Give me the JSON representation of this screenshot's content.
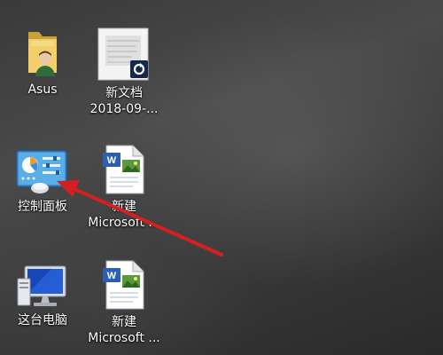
{
  "desktop": {
    "icons": [
      {
        "id": "asus",
        "label_lines": [
          "Asus"
        ],
        "icon": "user-folder-icon"
      },
      {
        "id": "doc-2018",
        "label_lines": [
          "新文档",
          "2018-09-..."
        ],
        "icon": "document-thumbnail-icon"
      },
      {
        "id": "control-panel",
        "label_lines": [
          "控制面板"
        ],
        "icon": "control-panel-icon"
      },
      {
        "id": "word-1",
        "label_lines": [
          "新建",
          "Microsoft ..."
        ],
        "icon": "word-document-icon"
      },
      {
        "id": "this-pc",
        "label_lines": [
          "这台电脑"
        ],
        "icon": "computer-monitor-icon"
      },
      {
        "id": "word-2",
        "label_lines": [
          "新建",
          "Microsoft ..."
        ],
        "icon": "word-document-icon"
      }
    ]
  },
  "annotation": {
    "arrow_color": "#d42020",
    "points_to": "control-panel"
  }
}
